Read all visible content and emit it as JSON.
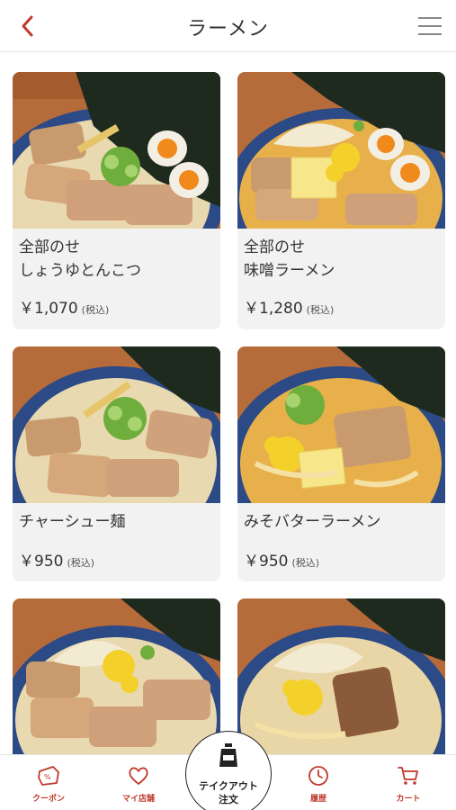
{
  "header": {
    "title": "ラーメン"
  },
  "products": [
    {
      "name_line1": "全部のせ",
      "name_line2": "しょうゆとんこつ",
      "price": "￥1,070",
      "tax": "(税込)"
    },
    {
      "name_line1": "全部のせ",
      "name_line2": "味噌ラーメン",
      "price": "￥1,280",
      "tax": "(税込)"
    },
    {
      "name_line1": "チャーシュー麺",
      "price": "￥950",
      "tax": "(税込)"
    },
    {
      "name_line1": "みそバターラーメン",
      "price": "￥950",
      "tax": "(税込)"
    }
  ],
  "tabbar": {
    "coupon": "クーポン",
    "my_store": "マイ店舗",
    "takeout_line1": "テイクアウト",
    "takeout_line2": "注文",
    "history": "履歴",
    "cart": "カート"
  },
  "colors": {
    "accent": "#c0392b",
    "card_bg": "#f2f2f2",
    "broth_shoyu": "#e9d9b0",
    "broth_miso": "#e8b04a",
    "bowl": "#2b4a86",
    "nori": "#1f2a1e",
    "wood": "#b56b3a"
  },
  "icons": [
    "back-chevron-icon",
    "hamburger-menu-icon",
    "coupon-icon",
    "heart-icon",
    "takeout-bag-icon",
    "clock-icon",
    "cart-icon"
  ]
}
